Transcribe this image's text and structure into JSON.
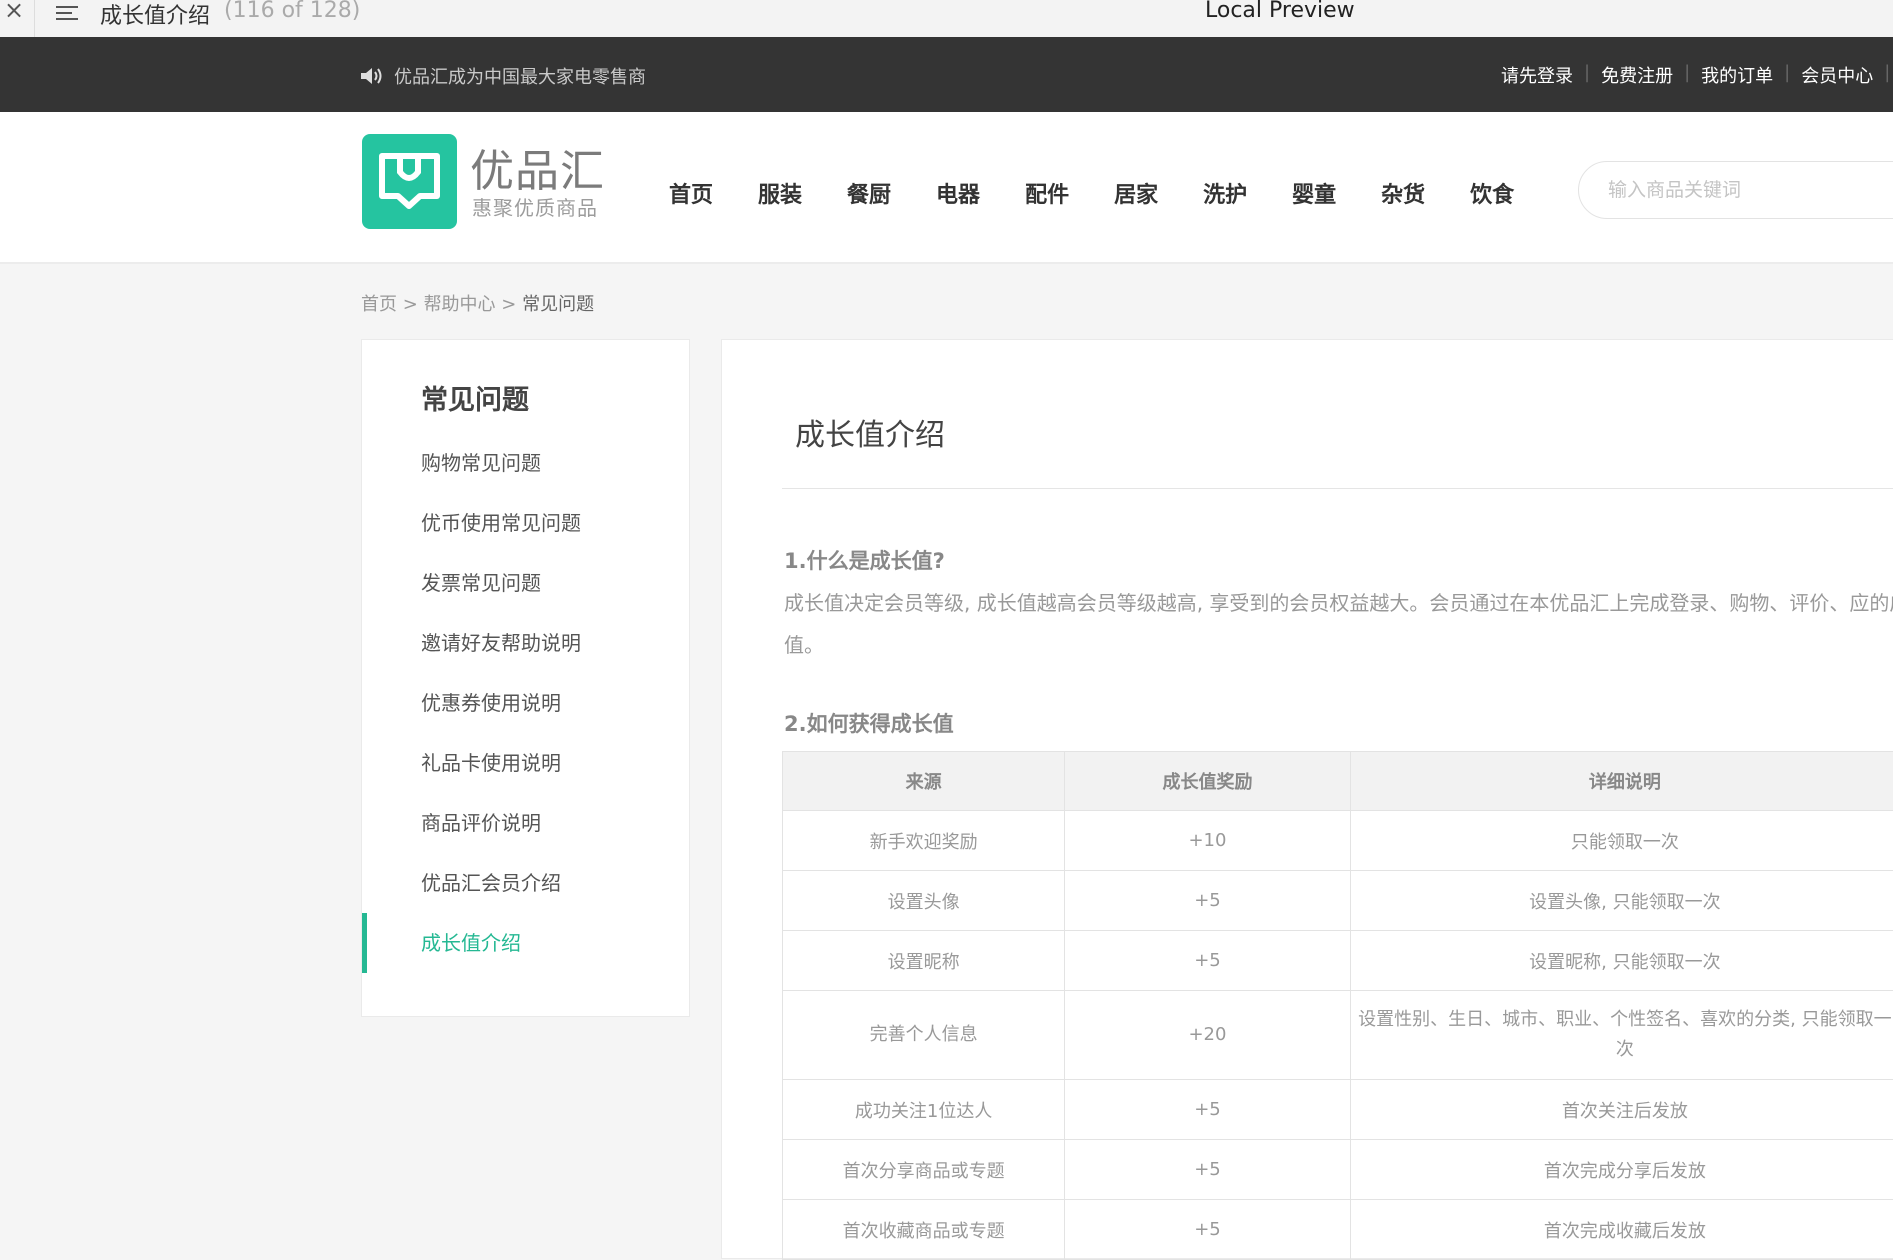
{
  "preview": {
    "close": "×",
    "doc_title": "成长值介绍",
    "count": "(116 of 128)",
    "app_name": "Local Preview"
  },
  "topbar": {
    "notice": "优品汇成为中国最大家电零售商",
    "links": [
      "请先登录",
      "免费注册",
      "我的订单",
      "会员中心"
    ],
    "divider": "|"
  },
  "header": {
    "logo_name": "优品汇",
    "logo_slogan": "惠聚优质商品",
    "nav": [
      "首页",
      "服装",
      "餐厨",
      "电器",
      "配件",
      "居家",
      "洗护",
      "婴童",
      "杂货",
      "饮食"
    ],
    "search_placeholder": "输入商品关键词"
  },
  "breadcrumb": {
    "items": [
      "首页",
      "帮助中心",
      "常见问题"
    ],
    "separator": ">"
  },
  "sidebar": {
    "title": "常见问题",
    "items": [
      {
        "label": "购物常见问题"
      },
      {
        "label": "优币使用常见问题"
      },
      {
        "label": "发票常见问题"
      },
      {
        "label": "邀请好友帮助说明"
      },
      {
        "label": "优惠券使用说明"
      },
      {
        "label": "礼品卡使用说明"
      },
      {
        "label": "商品评价说明"
      },
      {
        "label": "优品汇会员介绍"
      },
      {
        "label": "成长值介绍"
      }
    ]
  },
  "content": {
    "title": "成长值介绍",
    "q1": "1.什么是成长值?",
    "p1": "成长值决定会员等级, 成长值越高会员等级越高, 享受到的会员权益越大。会员通过在本优品汇上完成登录、购物、评价、应的成长值。",
    "q2": "2.如何获得成长值",
    "table": {
      "headers": [
        "来源",
        "成长值奖励",
        "详细说明"
      ],
      "rows": [
        [
          "新手欢迎奖励",
          "+10",
          "只能领取一次"
        ],
        [
          "设置头像",
          "+5",
          "设置头像, 只能领取一次"
        ],
        [
          "设置昵称",
          "+5",
          "设置昵称, 只能领取一次"
        ],
        [
          "完善个人信息",
          "+20",
          "设置性别、生日、城市、职业、个性签名、喜欢的分类, 只能领取一次"
        ],
        [
          "成功关注1位达人",
          "+5",
          "首次关注后发放"
        ],
        [
          "首次分享商品或专题",
          "+5",
          "首次完成分享后发放"
        ],
        [
          "首次收藏商品或专题",
          "+5",
          "首次完成收藏后发放"
        ]
      ]
    }
  },
  "colors": {
    "brand": "#25c4a0",
    "active": "#25b893",
    "topbar": "#343434"
  }
}
